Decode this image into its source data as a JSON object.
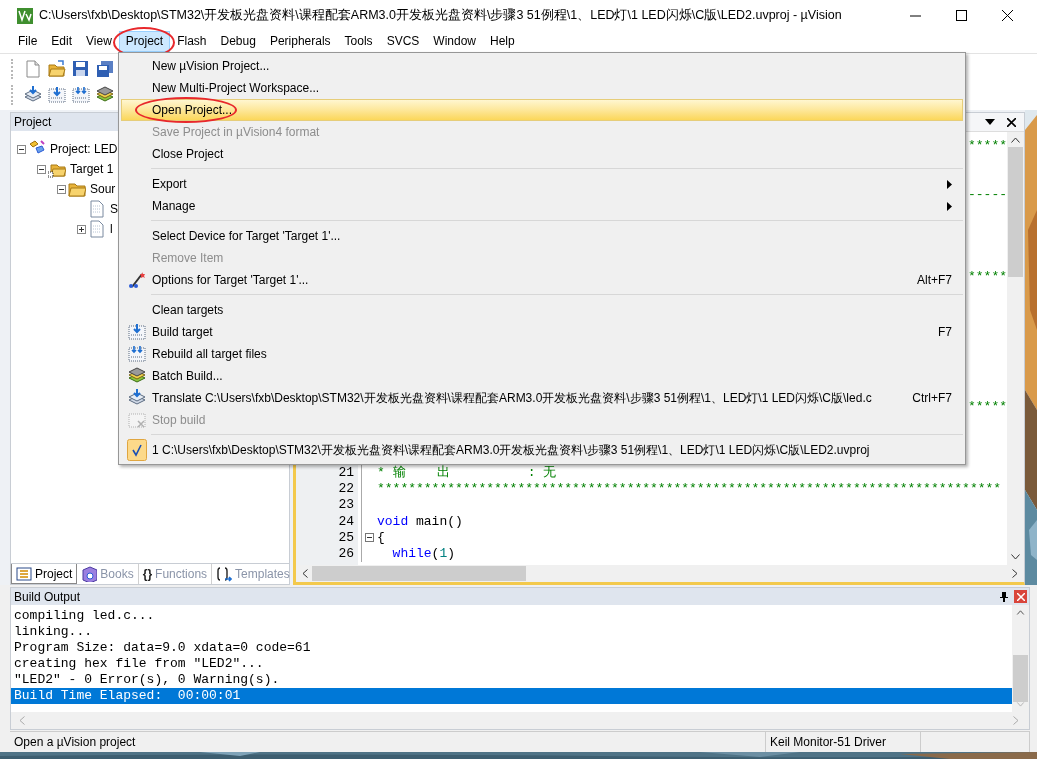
{
  "window": {
    "title": "C:\\Users\\fxb\\Desktop\\STM32\\开发板光盘资料\\课程配套ARM3.0开发板光盘资料\\步骤3 51例程\\1、LED灯\\1 LED闪烁\\C版\\LED2.uvproj - µVision"
  },
  "menubar": [
    {
      "label": "File",
      "selected": false,
      "circled": false
    },
    {
      "label": "Edit",
      "selected": false,
      "circled": false
    },
    {
      "label": "View",
      "selected": false,
      "circled": false
    },
    {
      "label": "Project",
      "selected": true,
      "circled": true
    },
    {
      "label": "Flash",
      "selected": false,
      "circled": false
    },
    {
      "label": "Debug",
      "selected": false,
      "circled": false
    },
    {
      "label": "Peripherals",
      "selected": false,
      "circled": false
    },
    {
      "label": "Tools",
      "selected": false,
      "circled": false
    },
    {
      "label": "SVCS",
      "selected": false,
      "circled": false
    },
    {
      "label": "Window",
      "selected": false,
      "circled": false
    },
    {
      "label": "Help",
      "selected": false,
      "circled": false
    }
  ],
  "project_panel": {
    "title": "Project",
    "tree": [
      {
        "kind": "project",
        "label": "Project: LED",
        "expanded": true,
        "children": [
          {
            "kind": "target",
            "label": "Target 1",
            "expanded": true,
            "children": [
              {
                "kind": "group",
                "label": "Sour",
                "expanded": true,
                "children": [
                  {
                    "kind": "file",
                    "label": "S"
                  },
                  {
                    "kind": "file",
                    "label": "l",
                    "expanded": false
                  }
                ]
              }
            ]
          }
        ]
      }
    ],
    "tabs": [
      {
        "kind": "project",
        "label": "Project",
        "selected": true
      },
      {
        "kind": "books",
        "label": "Books",
        "selected": false
      },
      {
        "kind": "functions",
        "glyph": "{}",
        "label": "Functions",
        "selected": false
      },
      {
        "kind": "templates",
        "label": "Templates",
        "selected": false
      }
    ]
  },
  "editor": {
    "covered_tails": [
      {
        "text": "*****"
      },
      {
        "text": "-----"
      },
      {
        "text": "*****"
      },
      {
        "text": "*****"
      }
    ],
    "lines": [
      {
        "number": "21",
        "fold_box": false,
        "tokens": [
          {
            "kind": "comment",
            "text": "* 输    出          : 无"
          }
        ]
      },
      {
        "number": "22",
        "fold_box": false,
        "tokens": [
          {
            "kind": "comment",
            "text": "********************************************************************************"
          }
        ]
      },
      {
        "number": "23",
        "fold_box": false
      },
      {
        "number": "24",
        "fold_box": false,
        "tokens": [
          {
            "kind": "keyword",
            "text": "void"
          },
          {
            "kind": "plain",
            "text": " main()"
          }
        ]
      },
      {
        "number": "25",
        "fold_box": true,
        "tokens": [
          {
            "kind": "plain",
            "text": "{"
          }
        ]
      },
      {
        "number": "26",
        "fold_box": false,
        "tokens": [
          {
            "kind": "keyword",
            "text": "  while"
          },
          {
            "kind": "plain",
            "text": "("
          },
          {
            "kind": "number",
            "text": "1"
          },
          {
            "kind": "plain",
            "text": ")"
          }
        ]
      }
    ]
  },
  "menu": {
    "items": [
      {
        "kind": "plain",
        "label": "New µVision Project...",
        "selected": false,
        "disabled": false,
        "circled": false
      },
      {
        "kind": "plain",
        "label": "New Multi-Project Workspace...",
        "selected": false,
        "disabled": false,
        "circled": false
      },
      {
        "kind": "plain",
        "label": "Open Project...",
        "selected": true,
        "disabled": false,
        "circled": true
      },
      {
        "kind": "plain",
        "label": "Save Project in µVision4 format",
        "selected": false,
        "disabled": true,
        "circled": false
      },
      {
        "kind": "plain",
        "label": "Close Project",
        "selected": false,
        "disabled": false,
        "circled": false
      },
      {
        "kind": "separator"
      },
      {
        "kind": "submenu",
        "label": "Export",
        "selected": false,
        "disabled": false,
        "circled": false
      },
      {
        "kind": "submenu",
        "label": "Manage",
        "selected": false,
        "disabled": false,
        "circled": false
      },
      {
        "kind": "separator"
      },
      {
        "kind": "plain",
        "label": "Select Device for Target 'Target 1'...",
        "selected": false,
        "disabled": false,
        "circled": false
      },
      {
        "kind": "plain",
        "label": "Remove Item",
        "selected": false,
        "disabled": true,
        "circled": false
      },
      {
        "kind": "wand",
        "label": "Options for Target 'Target 1'...",
        "shortcut": "Alt+F7",
        "selected": false,
        "disabled": false,
        "circled": false
      },
      {
        "kind": "separator"
      },
      {
        "kind": "plain",
        "label": "Clean targets",
        "selected": false,
        "disabled": false,
        "circled": false
      },
      {
        "kind": "build",
        "label": "Build target",
        "shortcut": "F7",
        "selected": false,
        "disabled": false,
        "circled": false
      },
      {
        "kind": "rebuild",
        "label": "Rebuild all target files",
        "selected": false,
        "disabled": false,
        "circled": false
      },
      {
        "kind": "batch",
        "label": "Batch Build...",
        "selected": false,
        "disabled": false,
        "circled": false
      },
      {
        "kind": "translate",
        "label": "Translate C:\\Users\\fxb\\Desktop\\STM32\\开发板光盘资料\\课程配套ARM3.0开发板光盘资料\\步骤3 51例程\\1、LED灯\\1 LED闪烁\\C版\\led.c",
        "shortcut": "Ctrl+F7",
        "selected": false,
        "disabled": false,
        "circled": false
      },
      {
        "kind": "stop",
        "label": "Stop build",
        "selected": false,
        "disabled": true,
        "circled": false
      },
      {
        "kind": "separator"
      },
      {
        "kind": "recent",
        "label": "1 C:\\Users\\fxb\\Desktop\\STM32\\开发板光盘资料\\课程配套ARM3.0开发板光盘资料\\步骤3 51例程\\1、LED灯\\1 LED闪烁\\C版\\LED2.uvproj",
        "checked": true,
        "selected": false,
        "disabled": false,
        "circled": false
      }
    ]
  },
  "build_output": {
    "title": "Build Output",
    "lines": [
      {
        "text": "compiling led.c...",
        "selected": false
      },
      {
        "text": "linking...",
        "selected": false
      },
      {
        "text": "Program Size: data=9.0 xdata=0 code=61",
        "selected": false
      },
      {
        "text": "creating hex file from \"LED2\"...",
        "selected": false
      },
      {
        "text": "\"LED2\" - 0 Error(s), 0 Warning(s).",
        "selected": false
      },
      {
        "text": "Build Time Elapsed:  00:00:01",
        "selected": true
      }
    ]
  },
  "status_bar": [
    "Open a µVision project",
    "Keil Monitor-51 Driver"
  ]
}
